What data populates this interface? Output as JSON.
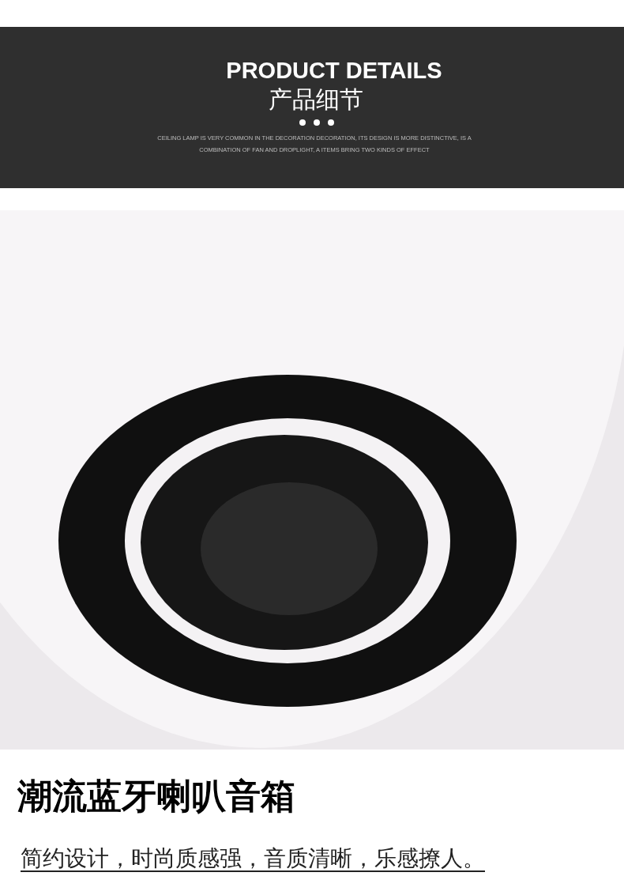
{
  "header": {
    "title": "PRODUCT DETAILS",
    "subtitle": "产品细节",
    "description_lines": [
      "CEILING LAMP IS VERY COMMON IN THE DECORATION DECORATION, ITS DESIGN IS MORE DISTINCTIVE, IS A",
      "COMBINATION OF FAN AND DROPLIGHT, A ITEMS BRING TWO KINDS OF EFFECT"
    ]
  },
  "feature": {
    "title": "潮流蓝牙喇叭音箱",
    "caption": "简约设计，时尚质感强，音质清晰，乐感撩人。"
  }
}
